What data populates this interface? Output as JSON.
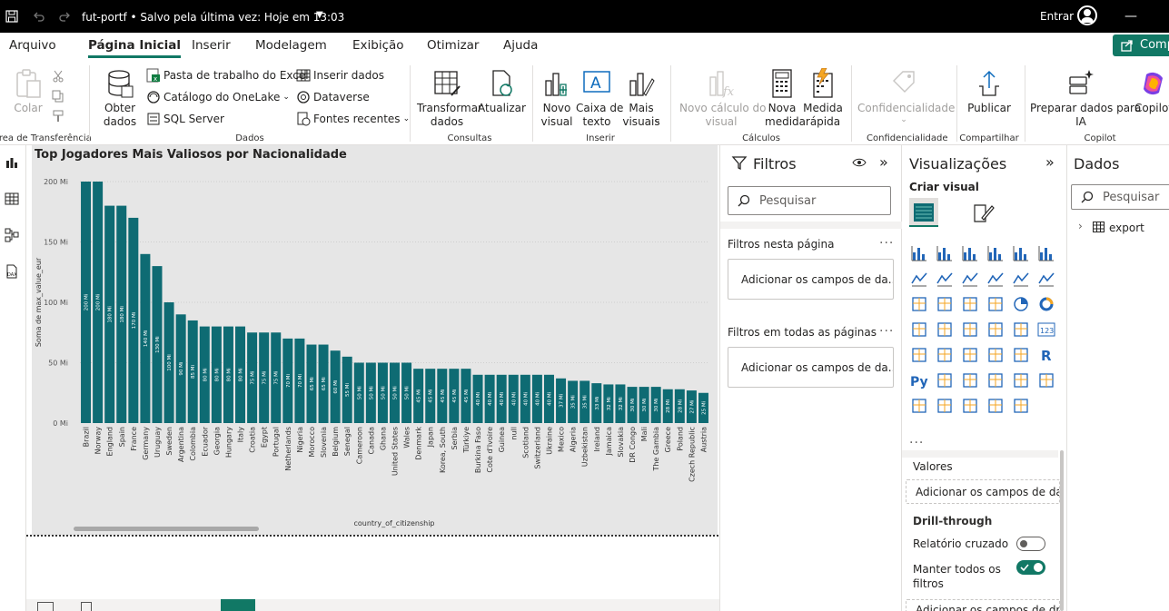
{
  "titlebar": {
    "document": "fut-portf • Salvo pela última vez: Hoje em 13:03",
    "signin": "Entrar"
  },
  "menu": {
    "tabs": [
      "Arquivo",
      "Página Inicial",
      "Inserir",
      "Modelagem",
      "Exibição",
      "Otimizar",
      "Ajuda"
    ],
    "active": "Página Inicial",
    "share": "Comp"
  },
  "ribbon": {
    "clipboard": {
      "paste": "Colar",
      "group": "Área de Transferência"
    },
    "data": {
      "get_data": "Obter\ndados",
      "excel": "Pasta de trabalho do Excel",
      "onelake": "Catálogo do OneLake",
      "sql": "SQL Server",
      "insert_data": "Inserir dados",
      "dataverse": "Dataverse",
      "recent": "Fontes recentes",
      "group": "Dados"
    },
    "queries": {
      "transform": "Transformar\ndados",
      "refresh": "Atualizar",
      "group": "Consultas"
    },
    "insert": {
      "new_visual": "Novo\nvisual",
      "text_box": "Caixa de\ntexto",
      "more_visuals": "Mais\nvisuais",
      "group": "Inserir"
    },
    "calc": {
      "new_calc": "Novo cálculo do\nvisual",
      "new_measure": "Nova\nmedida",
      "quick_measure": "Medida\nrápida",
      "group": "Cálculos"
    },
    "sensitivity": {
      "label": "Confidencialidade",
      "group": "Confidencialidade"
    },
    "share": {
      "publish": "Publicar",
      "group": "Compartilhar"
    },
    "copilot": {
      "prepare": "Preparar dados para\nIA",
      "copilot": "Copilot",
      "group": "Copilot"
    }
  },
  "chart_data": {
    "type": "bar",
    "title": "Top Jogadores Mais Valiosos por Nacionalidade",
    "xlabel": "country_of_citizenship",
    "ylabel": "Soma de max_value_eur",
    "yticks": [
      "0 Mi",
      "50 Mi",
      "100 Mi",
      "150 Mi",
      "200 Mi"
    ],
    "ylim": [
      0,
      200
    ],
    "categories": [
      "Brazil",
      "Norway",
      "England",
      "Spain",
      "France",
      "Germany",
      "Uruguay",
      "Sweden",
      "Argentina",
      "Colombia",
      "Ecuador",
      "Georgia",
      "Hungary",
      "Italy",
      "Croatia",
      "Egypt",
      "Portugal",
      "Netherlands",
      "Nigeria",
      "Morocco",
      "Slovenia",
      "Belgium",
      "Senegal",
      "Cameroon",
      "Canada",
      "Ghana",
      "United States",
      "Wales",
      "Denmark",
      "Japan",
      "Korea, South",
      "Serbia",
      "Türkiye",
      "Burkina Faso",
      "Cote d'Ivoire",
      "Guinea",
      "null",
      "Scotland",
      "Switzerland",
      "Ukraine",
      "Mexico",
      "Algeria",
      "Uzbekistan",
      "Ireland",
      "Jamaica",
      "Slovakia",
      "DR Congo",
      "Mali",
      "The Gambia",
      "Greece",
      "Poland",
      "Czech Republic",
      "Austria"
    ],
    "values": [
      200,
      200,
      180,
      180,
      170,
      140,
      130,
      100,
      90,
      85,
      80,
      80,
      80,
      80,
      75,
      75,
      75,
      70,
      70,
      65,
      65,
      60,
      55,
      50,
      50,
      50,
      50,
      50,
      45,
      45,
      45,
      45,
      45,
      40,
      40,
      40,
      40,
      40,
      40,
      40,
      37,
      35,
      35,
      33,
      32,
      32,
      30,
      30,
      30,
      28,
      28,
      27,
      25
    ],
    "labels": [
      "200 Mi",
      "200 Mi",
      "180 Mi",
      "180 Mi",
      "170 Mi",
      "140 Mi",
      "130 Mi",
      "100 Mi",
      "90 Mi",
      "85 Mi",
      "80 Mi",
      "80 Mi",
      "80 Mi",
      "80 Mi",
      "75 Mi",
      "75 Mi",
      "75 Mi",
      "70 Mi",
      "70 Mi",
      "65 Mi",
      "65 Mi",
      "60 Mi",
      "55 Mi",
      "50 Mi",
      "50 Mi",
      "50 Mi",
      "50 Mi",
      "50 Mi",
      "45 Mi",
      "45 Mi",
      "45 Mi",
      "45 Mi",
      "45 Mi",
      "40 Mi",
      "40 Mi",
      "40 Mi",
      "40 Mi",
      "40 Mi",
      "40 Mi",
      "40 Mi",
      "37 Mi",
      "35 Mi",
      "35 Mi",
      "33 Mi",
      "32 Mi",
      "32 Mi",
      "30 Mi",
      "30 Mi",
      "30 Mi",
      "28 Mi",
      "28 Mi",
      "27 Mi",
      "25 Mi"
    ],
    "bar_color": "#0e6b73",
    "grid": true
  },
  "filters": {
    "title": "Filtros",
    "search_placeholder": "Pesquisar",
    "page_section": "Filtros nesta página",
    "page_well": "Adicionar os campos de da...",
    "all_section": "Filtros em todas as páginas",
    "all_well": "Adicionar os campos de da..."
  },
  "viz": {
    "title": "Visualizações",
    "build": "Criar visual",
    "values": "Valores",
    "values_well": "Adicionar os campos de da...",
    "drill": "Drill-through",
    "cross_report": "Relatório cruzado",
    "keep_filters": "Manter todos os\nfiltros",
    "bottom_well": "Adicionar os campos de dr...",
    "more": "..."
  },
  "data_pane": {
    "title": "Dados",
    "search_placeholder": "Pesquisar",
    "table": "export"
  },
  "colors": {
    "accent": "#117865",
    "bar": "#0e6b73"
  }
}
